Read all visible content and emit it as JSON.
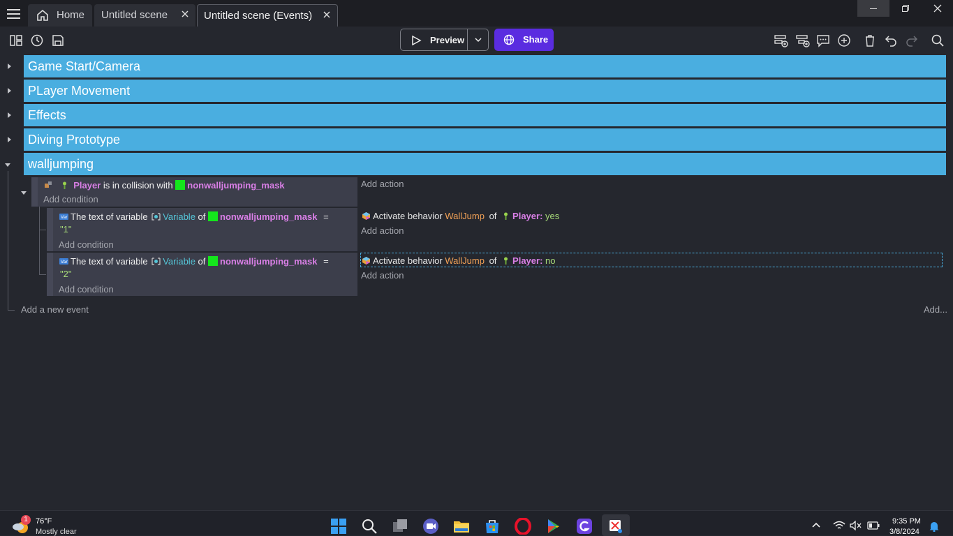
{
  "titlebar": {
    "tabs": [
      {
        "label": "Home"
      },
      {
        "label": "Untitled scene"
      },
      {
        "label": "Untitled scene (Events)"
      }
    ]
  },
  "toolbar": {
    "preview_label": "Preview",
    "share_label": "Share"
  },
  "groups": [
    {
      "label": "Game Start/Camera"
    },
    {
      "label": "PLayer Movement"
    },
    {
      "label": "Effects"
    },
    {
      "label": "Diving Prototype"
    },
    {
      "label": "walljumping"
    }
  ],
  "event1": {
    "object": "Player",
    "middle": "is in collision with",
    "target": "nonwalljumping_mask",
    "add_condition": "Add condition",
    "add_action": "Add action"
  },
  "subevents": [
    {
      "cond_prefix": "The text of variable",
      "variable": "Variable",
      "of": "of",
      "object": "nonwalljumping_mask",
      "eq": "=",
      "value": "\"1\"",
      "add_condition": "Add condition",
      "action_prefix": "Activate behavior",
      "behavior": "WallJump",
      "action_of": "of",
      "action_object": "Player:",
      "action_value": "yes",
      "add_action": "Add action"
    },
    {
      "cond_prefix": "The text of variable",
      "variable": "Variable",
      "of": "of",
      "object": "nonwalljumping_mask",
      "eq": "=",
      "value": "\"2\"",
      "add_condition": "Add condition",
      "action_prefix": "Activate behavior",
      "behavior": "WallJump",
      "action_of": "of",
      "action_object": "Player:",
      "action_value": "no",
      "add_action": "Add action"
    }
  ],
  "footer": {
    "add_event": "Add a new event",
    "add_more": "Add..."
  },
  "taskbar": {
    "weather_temp": "76°F",
    "weather_desc": "Mostly clear",
    "weather_badge": "1",
    "time": "9:35 PM",
    "date": "3/8/2024"
  },
  "colors": {
    "group_bg": "#4aaee0",
    "share_bg": "#5a2ce0",
    "object_name": "#d97fe6",
    "variable_name": "#55c6d8",
    "behavior_name": "#f0a056"
  }
}
